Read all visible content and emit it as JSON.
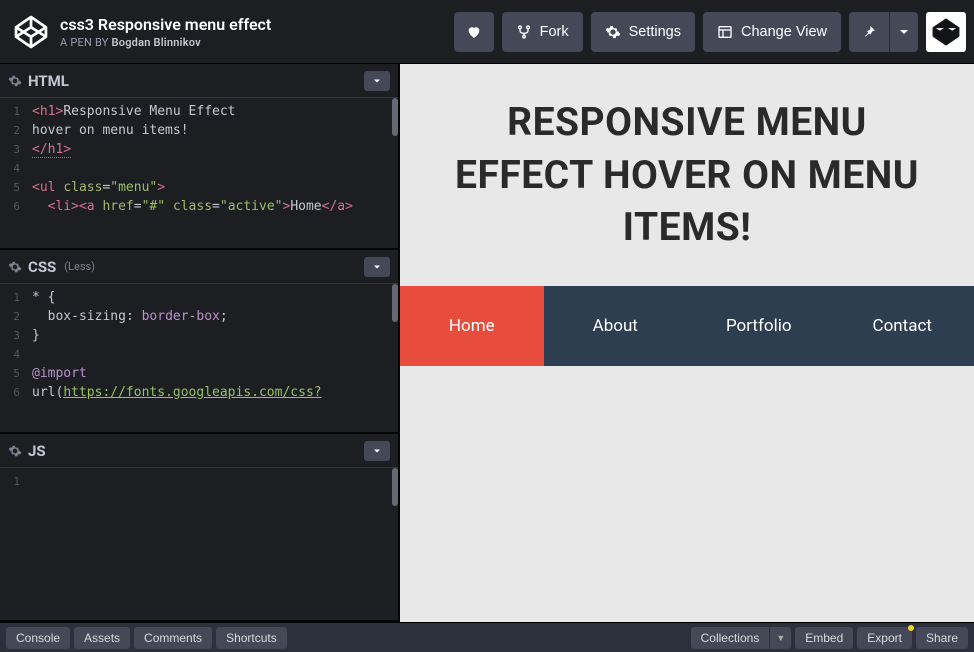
{
  "header": {
    "title": "css3 Responsive menu effect",
    "byline_prefix": "A PEN BY ",
    "author": "Bogdan Blinnikov",
    "fork": "Fork",
    "settings": "Settings",
    "change_view": "Change View"
  },
  "panels": {
    "html": {
      "title": "HTML"
    },
    "css": {
      "title": "CSS",
      "sub": "(Less)"
    },
    "js": {
      "title": "JS"
    }
  },
  "code_html": {
    "lines": [
      "1",
      "2",
      "3",
      "4",
      "5",
      "6"
    ],
    "l1a": "<h1>",
    "l1b": "Responsive Menu Effect",
    "l2": "hover on menu items!",
    "l3": "</h1>",
    "l5a": "<ul ",
    "l5b": "class",
    "l5c": "=",
    "l5d": "\"menu\"",
    "l5e": ">",
    "l6a": "<li><a ",
    "l6b": "href",
    "l6c": "=",
    "l6d": "\"#\"",
    "l6e": " class",
    "l6f": "=",
    "l6g": "\"active\"",
    "l6h": ">",
    "l6i": "Home",
    "l6j": "</a>"
  },
  "code_css": {
    "lines": [
      "1",
      "2",
      "3",
      "4",
      "5",
      "6"
    ],
    "l1": "* {",
    "l2a": "box-sizing",
    "l2b": ": ",
    "l2c": "border-box",
    "l2d": ";",
    "l3": "}",
    "l5": "@import",
    "l6a": "url(",
    "l6b": "https://fonts.googleapis.com/css?"
  },
  "code_js": {
    "lines": [
      "1"
    ]
  },
  "preview": {
    "heading": "Responsive Menu Effect hover on menu items!",
    "menu": [
      "Home",
      "About",
      "Portfolio",
      "Contact"
    ],
    "active_index": 0
  },
  "footer": {
    "left": [
      "Console",
      "Assets",
      "Comments",
      "Shortcuts"
    ],
    "collections": "Collections",
    "embed": "Embed",
    "export": "Export",
    "share": "Share"
  }
}
